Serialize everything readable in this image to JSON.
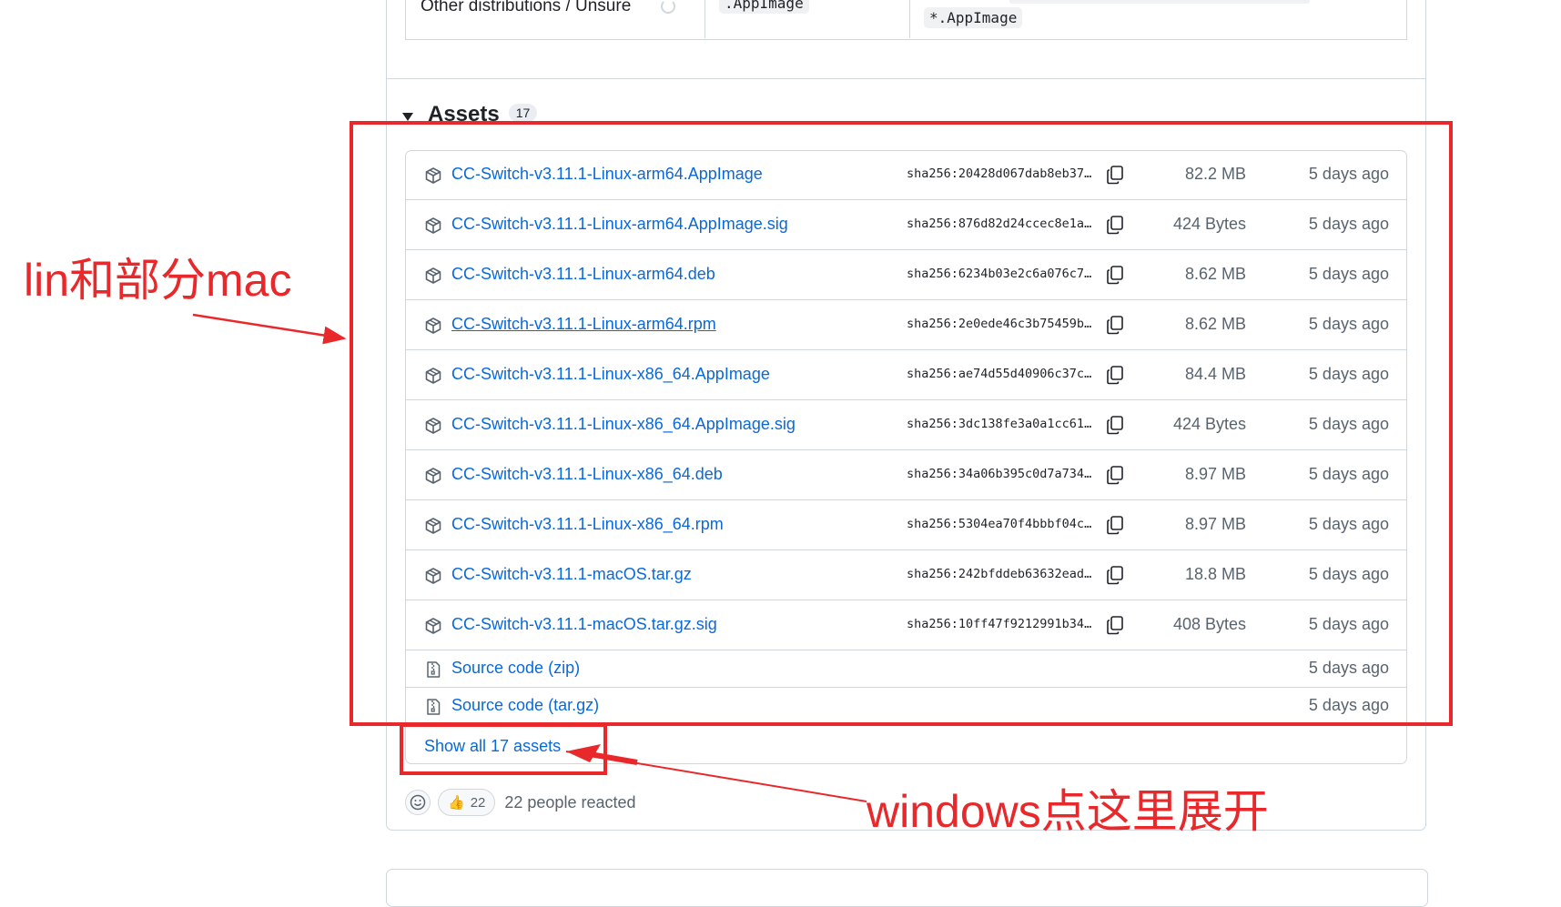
{
  "distributions": {
    "label": "Other distributions / Unsure",
    "chip_1": ".AppImage",
    "chip_2": "*.AppImage"
  },
  "assets": {
    "title": "Assets",
    "count": "17",
    "rows": [
      {
        "name": "CC-Switch-v3.11.1-Linux-arm64.AppImage",
        "digest": "sha256:20428d067dab8eb37…",
        "size": "82.2 MB",
        "date": "5 days ago"
      },
      {
        "name": "CC-Switch-v3.11.1-Linux-arm64.AppImage.sig",
        "digest": "sha256:876d82d24ccec8e1a…",
        "size": "424 Bytes",
        "date": "5 days ago"
      },
      {
        "name": "CC-Switch-v3.11.1-Linux-arm64.deb",
        "digest": "sha256:6234b03e2c6a076c7…",
        "size": "8.62 MB",
        "date": "5 days ago"
      },
      {
        "name": "CC-Switch-v3.11.1-Linux-arm64.rpm",
        "digest": "sha256:2e0ede46c3b75459b…",
        "size": "8.62 MB",
        "date": "5 days ago"
      },
      {
        "name": "CC-Switch-v3.11.1-Linux-x86_64.AppImage",
        "digest": "sha256:ae74d55d40906c37c…",
        "size": "84.4 MB",
        "date": "5 days ago"
      },
      {
        "name": "CC-Switch-v3.11.1-Linux-x86_64.AppImage.sig",
        "digest": "sha256:3dc138fe3a0a1cc61…",
        "size": "424 Bytes",
        "date": "5 days ago"
      },
      {
        "name": "CC-Switch-v3.11.1-Linux-x86_64.deb",
        "digest": "sha256:34a06b395c0d7a734…",
        "size": "8.97 MB",
        "date": "5 days ago"
      },
      {
        "name": "CC-Switch-v3.11.1-Linux-x86_64.rpm",
        "digest": "sha256:5304ea70f4bbbf04c…",
        "size": "8.97 MB",
        "date": "5 days ago"
      },
      {
        "name": "CC-Switch-v3.11.1-macOS.tar.gz",
        "digest": "sha256:242bfddeb63632ead…",
        "size": "18.8 MB",
        "date": "5 days ago"
      },
      {
        "name": "CC-Switch-v3.11.1-macOS.tar.gz.sig",
        "digest": "sha256:10ff47f9212991b34…",
        "size": "408 Bytes",
        "date": "5 days ago"
      }
    ],
    "source_rows": [
      {
        "label": "Source code",
        "ext": "(zip)",
        "date": "5 days ago"
      },
      {
        "label": "Source code",
        "ext": "(tar.gz)",
        "date": "5 days ago"
      }
    ],
    "show_all": "Show all 17 assets"
  },
  "reactions": {
    "emoji": "👍",
    "count": "22",
    "summary": "22 people reacted"
  },
  "annotations": {
    "linux_mac_note": "lin和部分mac",
    "windows_note": "windows点这里展开",
    "color": "#e8282b"
  }
}
